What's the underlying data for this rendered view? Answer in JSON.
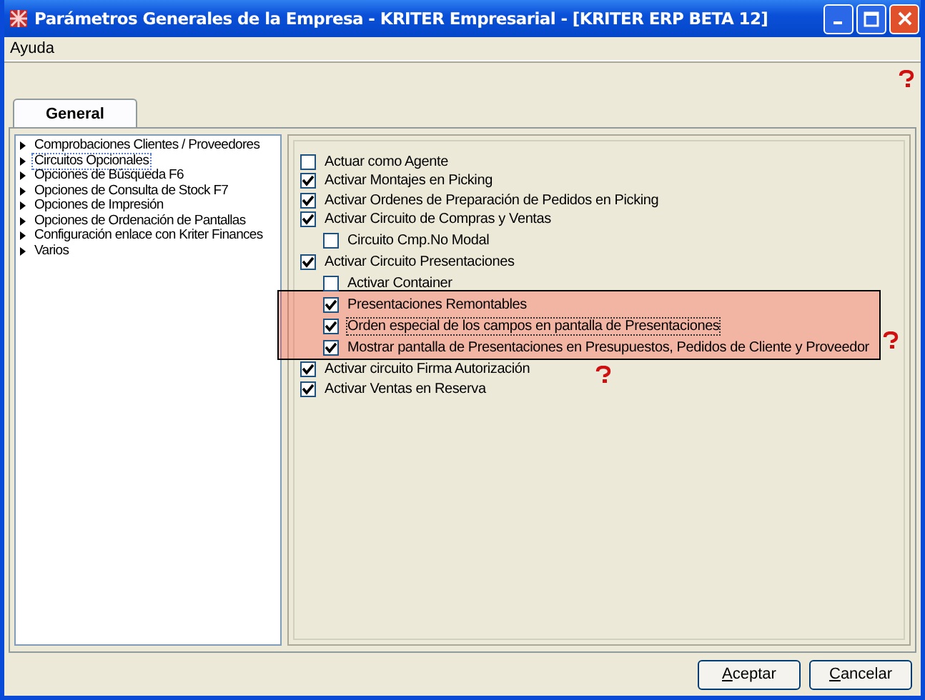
{
  "window": {
    "title": "Parámetros Generales de la Empresa - KRITER Empresarial - [KRITER ERP BETA 12]"
  },
  "menu": [
    "Ayuda"
  ],
  "tabs": [
    {
      "label": "General",
      "selected": true
    }
  ],
  "sidebar": {
    "items": [
      {
        "label": "Comprobaciones Clientes / Proveedores",
        "selected": false
      },
      {
        "label": "Circuitos Opcionales",
        "selected": true
      },
      {
        "label": "Opciones de Búsqueda F6",
        "selected": false
      },
      {
        "label": "Opciones de Consulta de Stock F7",
        "selected": false
      },
      {
        "label": "Opciones de Impresión",
        "selected": false
      },
      {
        "label": "Opciones de Ordenación de Pantallas",
        "selected": false
      },
      {
        "label": "Configuración enlace con Kriter Finances",
        "selected": false
      },
      {
        "label": "Varios",
        "selected": false
      }
    ]
  },
  "options": [
    {
      "label": "Actuar como Agente",
      "checked": false,
      "focused": false
    },
    {
      "label": "Activar Montajes en Picking",
      "checked": true,
      "focused": false
    },
    {
      "label": "Activar Ordenes de Preparación de Pedidos en Picking",
      "checked": true,
      "focused": false
    },
    {
      "label": "Activar Circuito de Compras y Ventas",
      "checked": true,
      "focused": false,
      "children": [
        {
          "label": "Circuito Cmp.No Modal",
          "checked": false,
          "focused": false
        }
      ]
    },
    {
      "label": "Activar Circuito Presentaciones",
      "checked": true,
      "focused": false,
      "children": [
        {
          "label": "Activar Container",
          "checked": false,
          "focused": false
        },
        {
          "label": "Presentaciones Remontables",
          "checked": true,
          "focused": false
        },
        {
          "label": "Orden especial de los campos en pantalla de Presentaciones",
          "checked": true,
          "focused": true
        },
        {
          "label": "Mostrar pantalla de Presentaciones en Presupuestos, Pedidos de Cliente y Proveedor",
          "checked": true,
          "focused": false
        }
      ]
    },
    {
      "label": "Activar circuito Firma Autorización",
      "checked": true,
      "focused": false
    },
    {
      "label": "Activar Ventas en Reserva",
      "checked": true,
      "focused": false
    }
  ],
  "buttons": [
    {
      "label": "Aceptar"
    },
    {
      "label": "Cancelar"
    }
  ]
}
